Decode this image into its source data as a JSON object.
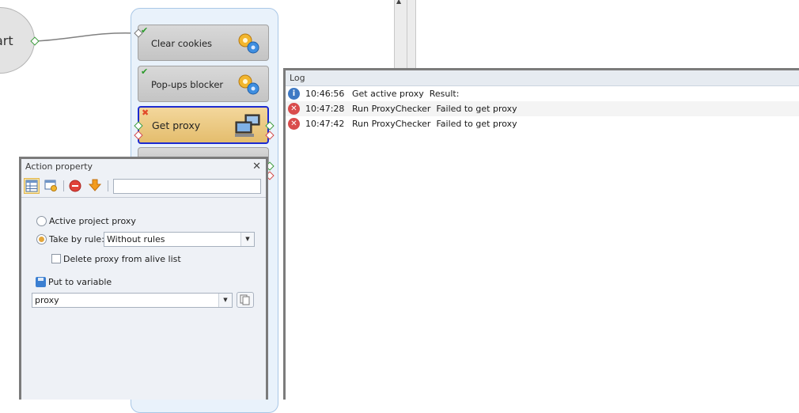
{
  "canvas": {
    "start_label": "art",
    "nodes": [
      {
        "label": "Clear cookies",
        "status": "✔",
        "icon": "gears-icon"
      },
      {
        "label": "Pop-ups blocker",
        "status": "✔",
        "icon": "gears-icon"
      },
      {
        "label": "Get proxy",
        "status": "✖",
        "icon": "network-computers-icon"
      }
    ]
  },
  "log": {
    "title": "Log",
    "entries": [
      {
        "icon": "info-icon",
        "glyph": "i",
        "time": "10:46:56",
        "message": "Get active proxy  Result:"
      },
      {
        "icon": "error-icon",
        "glyph": "✕",
        "time": "10:47:28",
        "message": "Run ProxyChecker  Failed to get proxy"
      },
      {
        "icon": "error-icon",
        "glyph": "✕",
        "time": "10:47:42",
        "message": "Run ProxyChecker  Failed to get proxy"
      }
    ]
  },
  "action_property": {
    "title": "Action property",
    "close_glyph": "✕",
    "search_value": "",
    "active_project_proxy_label": "Active project proxy",
    "take_by_rule_label": "Take by rule:",
    "rule_selected": "Without rules",
    "delete_proxy_label": "Delete proxy from alive list",
    "put_to_variable_label": "Put to variable",
    "variable_value": "proxy"
  },
  "colors": {
    "selected_node_border": "#1c2ad1",
    "selected_node_fill": "#e9c77f",
    "success_check": "#2a9a2a",
    "fail_mark": "#e24a2a",
    "info_icon": "#3e79c4",
    "error_icon": "#d94c4c",
    "group_fill": "#e9f2fb"
  }
}
